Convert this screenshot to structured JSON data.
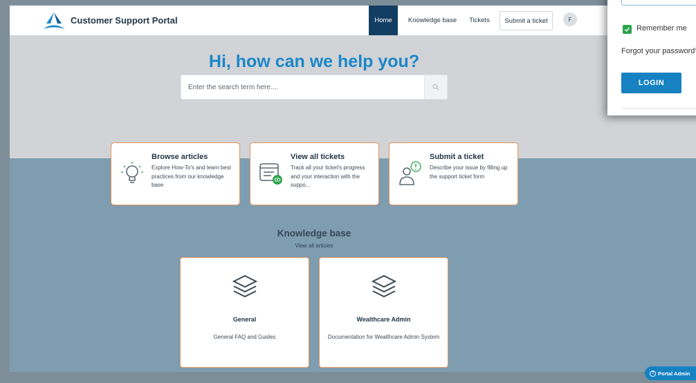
{
  "header": {
    "brand": "Customer Support Portal",
    "nav": {
      "home": "Home",
      "knowledge_base": "Knowledge base",
      "tickets": "Tickets",
      "submit_ticket": "Submit a ticket"
    },
    "avatar_initial": "F",
    "accent_color": "#1b87c9",
    "active_nav_color": "#123e63"
  },
  "hero": {
    "title": "Hi, how can we help you?",
    "search_placeholder": "Enter the search term here...."
  },
  "action_cards": [
    {
      "icon": "lightbulb-icon",
      "title": "Browse articles",
      "description": "Explore How-To's and learn best practices from our knowledge base"
    },
    {
      "icon": "tickets-icon",
      "title": "View all tickets",
      "description": "Track all your ticket's progress and your interaction with the suppo..."
    },
    {
      "icon": "person-alert-icon",
      "title": "Submit a ticket",
      "description": "Describe your issue by filling up the support ticket form"
    }
  ],
  "knowledge_base": {
    "title": "Knowledge base",
    "view_all": "View all articles",
    "categories": [
      {
        "icon": "layers-icon",
        "title": "General",
        "description": "General FAQ and Guides"
      },
      {
        "icon": "layers-icon",
        "title": "Wealthcare Admin",
        "description": "Documentation for Wealthcare Admin System"
      }
    ]
  },
  "login_popup": {
    "remember_label": "Remember me",
    "remember_checked": true,
    "forgot_label": "Forgot your password?",
    "login_button": "LOGIN"
  },
  "portal_admin": "Portal Admin"
}
